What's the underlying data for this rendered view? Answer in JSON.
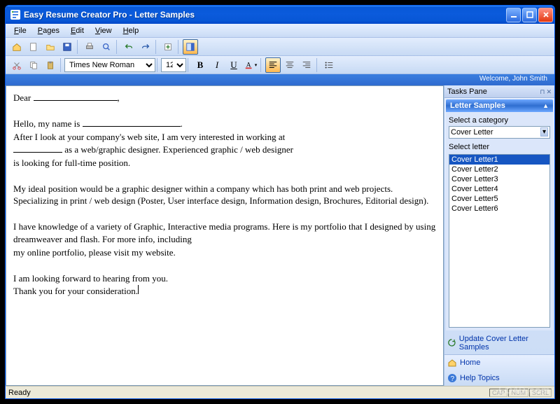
{
  "title": "Easy Resume Creator Pro - Letter Samples",
  "menus": [
    "File",
    "Pages",
    "Edit",
    "View",
    "Help"
  ],
  "font": {
    "name": "Times New Roman",
    "size": "12"
  },
  "welcome": "Welcome, John Smith",
  "document": {
    "p1_prefix": "Dear ",
    "p1_suffix": ",",
    "p3_prefix": "Hello, my name is ",
    "p3_suffix": ".",
    "p4": "After I look at your company's web site, I am very interested in working at",
    "p5_suffix": " as a web/graphic designer.  Experienced graphic / web designer",
    "p6": "is looking for full-time position.",
    "p7": "My ideal position would be a graphic designer within a company which has both print and web projects. Specializing in print / web design (Poster, User interface design, Information design, Brochures, Editorial design).",
    "p8": "I have knowledge of a variety of Graphic, Interactive media programs. Here is my portfolio that I designed by using dreamweaver and flash. For more info, including",
    "p9": "my online portfolio, please visit my website.",
    "p10": "I am looking forward to hearing from you.",
    "p11": "Thank you for your consideration."
  },
  "sidebar": {
    "tasks_label": "Tasks Pane",
    "panel_title": "Letter Samples",
    "cat_label": "Select a category",
    "cat_value": "Cover Letter",
    "letter_label": "Select letter",
    "letters": [
      "Cover Letter1",
      "Cover Letter2",
      "Cover Letter3",
      "Cover Letter4",
      "Cover Letter5",
      "Cover Letter6"
    ],
    "selected_letter_index": 0,
    "update_link": "Update Cover Letter Samples",
    "home_link": "Home",
    "help_link": "Help Topics"
  },
  "status": {
    "ready": "Ready",
    "caps": "CAP",
    "num": "NUM",
    "scrl": "SCRL"
  },
  "watermark": "LO4D.com"
}
